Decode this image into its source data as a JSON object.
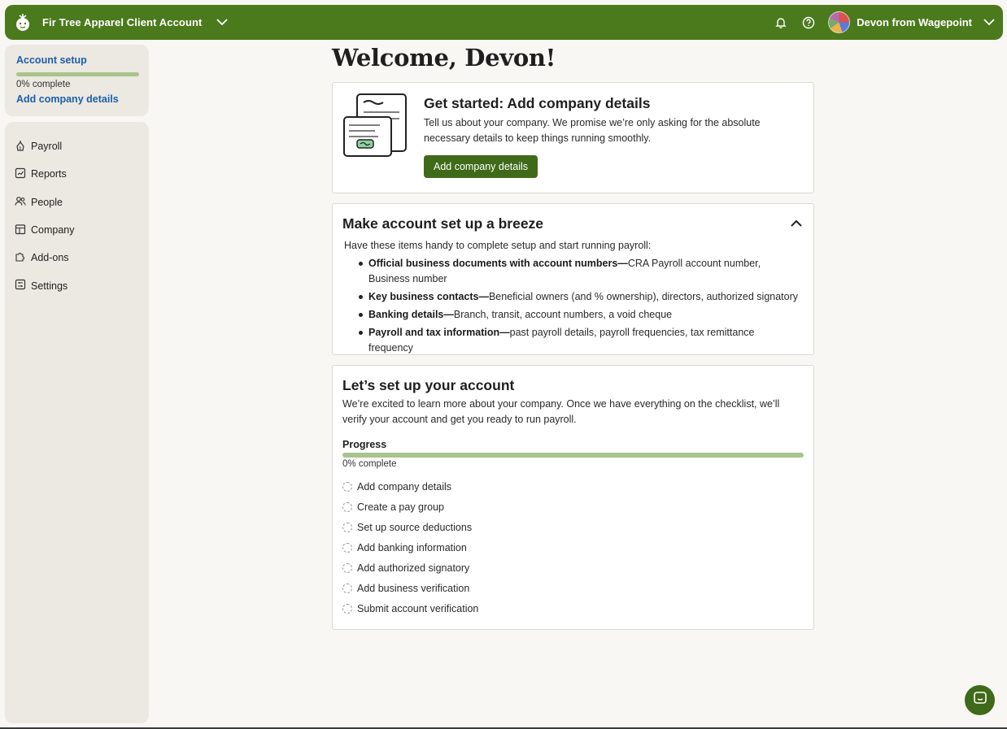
{
  "topbar": {
    "account_name": "Fir Tree Apparel Client Account",
    "user_name": "Devon from Wagepoint",
    "icons": [
      "logo-icon",
      "chevron-down-icon",
      "bell-icon",
      "help-icon",
      "avatar",
      "chevron-down-icon"
    ]
  },
  "setup": {
    "title": "Account setup",
    "percent_text": "0% complete",
    "progress": 0,
    "link": "Add company details"
  },
  "nav": {
    "items": [
      {
        "label": "Payroll",
        "icon": "payroll-icon"
      },
      {
        "label": "Reports",
        "icon": "reports-icon"
      },
      {
        "label": "People",
        "icon": "people-icon"
      },
      {
        "label": "Company",
        "icon": "company-icon"
      },
      {
        "label": "Add-ons",
        "icon": "addons-icon"
      },
      {
        "label": "Settings",
        "icon": "settings-icon"
      }
    ]
  },
  "main": {
    "welcome": "Welcome, Devon!",
    "get_started": {
      "title": "Get started: Add company details",
      "body": "Tell us about your company. We promise we’re only asking for the absolute necessary details to keep things running smoothly.",
      "button": "Add company details"
    },
    "breeze": {
      "title": "Make account set up a breeze",
      "intro": "Have these items handy to complete setup and start running payroll:",
      "items": [
        {
          "bold": "Official business documents with account numbers—",
          "text": "CRA Payroll account number, Business number"
        },
        {
          "bold": "Key business contacts—",
          "text": "Beneficial owners (and % ownership), directors, authorized signatory"
        },
        {
          "bold": "Banking details—",
          "text": "Branch, transit, account numbers, a void cheque"
        },
        {
          "bold": "Payroll and tax information—",
          "text": "past payroll details, payroll frequencies, tax remittance frequency"
        }
      ]
    },
    "setup_account": {
      "title": "Let’s set up your account",
      "body": "We’re excited to learn more about your company. Once we have everything on the checklist, we’ll verify your account and get you ready to run payroll.",
      "progress_label": "Progress",
      "progress": 0,
      "percent_text": "0% complete",
      "checklist": [
        "Add company details",
        "Create a pay group",
        "Set up source deductions",
        "Add banking information",
        "Add authorized signatory",
        "Add business verification",
        "Submit account verification"
      ]
    }
  },
  "colors": {
    "brand_green": "#4a7a1c",
    "button_green": "#3f6a19",
    "progress_green": "#a8c48c",
    "link_blue": "#1d5fa6",
    "sidebar_bg": "#ece8e2"
  }
}
